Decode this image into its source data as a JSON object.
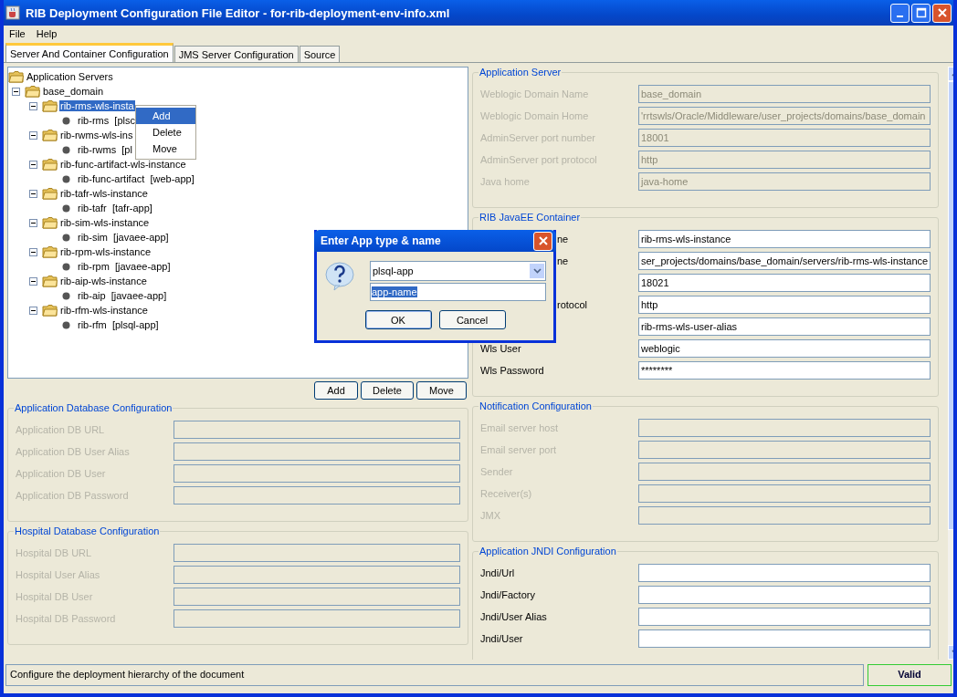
{
  "window": {
    "title": "RIB Deployment Configuration File Editor - for-rib-deployment-env-info.xml"
  },
  "menu_bar": [
    "File",
    "Help"
  ],
  "tabs": [
    {
      "label": "Server And Container Configuration",
      "selected": true
    },
    {
      "label": "JMS Server Configuration",
      "selected": false
    },
    {
      "label": "Source",
      "selected": false
    }
  ],
  "tree": {
    "label": "Application Servers",
    "kind": "folder",
    "selected": false,
    "children": [
      {
        "label": "base_domain",
        "kind": "folder",
        "selected": false,
        "expanded": true,
        "children": [
          {
            "label": "rib-rms-wls-insta",
            "kind": "folder",
            "selected": true,
            "expanded": true,
            "children": [
              {
                "label": "rib-rms  [plsc",
                "kind": "app",
                "selected": false
              }
            ]
          },
          {
            "label": "rib-rwms-wls-ins",
            "kind": "folder",
            "selected": false,
            "expanded": true,
            "children": [
              {
                "label": "rib-rwms  [pl",
                "kind": "app",
                "selected": false
              }
            ]
          },
          {
            "label": "rib-func-artifact-wls-instance",
            "kind": "folder",
            "selected": false,
            "expanded": true,
            "children": [
              {
                "label": "rib-func-artifact  [web-app]",
                "kind": "app",
                "selected": false
              }
            ]
          },
          {
            "label": "rib-tafr-wls-instance",
            "kind": "folder",
            "selected": false,
            "expanded": true,
            "children": [
              {
                "label": "rib-tafr  [tafr-app]",
                "kind": "app",
                "selected": false
              }
            ]
          },
          {
            "label": "rib-sim-wls-instance",
            "kind": "folder",
            "selected": false,
            "expanded": true,
            "children": [
              {
                "label": "rib-sim  [javaee-app]",
                "kind": "app",
                "selected": false
              }
            ]
          },
          {
            "label": "rib-rpm-wls-instance",
            "kind": "folder",
            "selected": false,
            "expanded": true,
            "children": [
              {
                "label": "rib-rpm  [javaee-app]",
                "kind": "app",
                "selected": false
              }
            ]
          },
          {
            "label": "rib-aip-wls-instance",
            "kind": "folder",
            "selected": false,
            "expanded": true,
            "children": [
              {
                "label": "rib-aip  [javaee-app]",
                "kind": "app",
                "selected": false
              }
            ]
          },
          {
            "label": "rib-rfm-wls-instance",
            "kind": "folder",
            "selected": false,
            "expanded": true,
            "children": [
              {
                "label": "rib-rfm  [plsql-app]",
                "kind": "app",
                "selected": false
              }
            ]
          }
        ]
      }
    ]
  },
  "context_menu": [
    {
      "label": "Add",
      "selected": true
    },
    {
      "label": "Delete",
      "selected": false
    },
    {
      "label": "Move",
      "selected": false
    }
  ],
  "tree_buttons": [
    "Add",
    "Delete",
    "Move"
  ],
  "left_groups": [
    {
      "title": "Application Database Configuration",
      "fields": [
        {
          "label": "Application DB URL",
          "disabled": true
        },
        {
          "label": "Application DB User Alias",
          "disabled": true
        },
        {
          "label": "Application DB User",
          "disabled": true
        },
        {
          "label": "Application DB Password",
          "disabled": true
        }
      ]
    },
    {
      "title": "Hospital Database Configuration",
      "fields": [
        {
          "label": "Hospital DB URL",
          "disabled": true
        },
        {
          "label": "Hospital User Alias",
          "disabled": true
        },
        {
          "label": "Hospital DB User",
          "disabled": true
        },
        {
          "label": "Hospital DB Password",
          "disabled": true
        }
      ]
    }
  ],
  "right_groups": [
    {
      "title": "Application Server",
      "fields": [
        {
          "label": "Weblogic Domain Name",
          "value": "base_domain",
          "disabled": true
        },
        {
          "label": "Weblogic Domain Home",
          "value": "'rrtswls/Oracle/Middleware/user_projects/domains/base_domain",
          "disabled": true
        },
        {
          "label": "AdminServer port number",
          "value": "18001",
          "disabled": true
        },
        {
          "label": "AdminServer port protocol",
          "value": "http",
          "disabled": true
        },
        {
          "label": "Java home",
          "value": "java-home",
          "disabled": true
        }
      ]
    },
    {
      "title": "RIB JavaEE Container",
      "fields": [
        {
          "label": "ne",
          "value": "rib-rms-wls-instance",
          "disabled": false,
          "covered": true
        },
        {
          "label": "ne",
          "value": "ser_projects/domains/base_domain/servers/rib-rms-wls-instance",
          "disabled": false,
          "covered": true
        },
        {
          "value": "18021",
          "disabled": false
        },
        {
          "label": "rotocol",
          "value": "http",
          "disabled": false,
          "covered": true
        },
        {
          "value": "rib-rms-wls-user-alias",
          "disabled": false
        },
        {
          "label": "Wls User",
          "value": "weblogic",
          "disabled": false,
          "covered": false
        },
        {
          "label": "Wls Password",
          "value": "********",
          "disabled": false,
          "covered": false
        }
      ]
    },
    {
      "title": "Notification Configuration",
      "fields": [
        {
          "label": "Email server host",
          "disabled": true
        },
        {
          "label": "Email server port",
          "disabled": true
        },
        {
          "label": "Sender",
          "disabled": true
        },
        {
          "label": "Receiver(s)",
          "disabled": true
        },
        {
          "label": "JMX",
          "disabled": true
        }
      ]
    },
    {
      "title": "Application JNDI Configuration",
      "fields": [
        {
          "label": "Jndi/Url",
          "disabled": false
        },
        {
          "label": "Jndi/Factory",
          "disabled": false
        },
        {
          "label": "Jndi/User Alias",
          "disabled": false
        },
        {
          "label": "Jndi/User",
          "disabled": false
        }
      ]
    }
  ],
  "dialog": {
    "title": "Enter App type & name",
    "type_value": "plsql-app",
    "name_value": "app-name",
    "name_selected": true,
    "buttons": [
      {
        "label": "OK",
        "default": true
      },
      {
        "label": "Cancel",
        "default": false
      }
    ]
  },
  "status_bar": {
    "message": "Configure the deployment hierarchy of the document",
    "validity": "Valid"
  }
}
